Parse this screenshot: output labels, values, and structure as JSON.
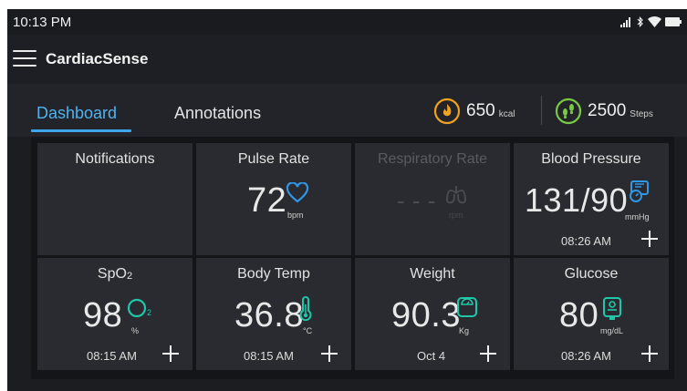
{
  "status_bar": {
    "time": "10:13 PM"
  },
  "app": {
    "title": "CardiacSense"
  },
  "tabs": [
    {
      "label": "Dashboard",
      "active": true
    },
    {
      "label": "Annotations",
      "active": false
    }
  ],
  "summary": {
    "calories": {
      "value": "650",
      "unit": "kcal",
      "icon": "flame-icon"
    },
    "steps": {
      "value": "2500",
      "unit": "Steps",
      "icon": "footsteps-icon"
    }
  },
  "tiles": [
    {
      "name": "Notifications"
    },
    {
      "name": "Pulse Rate",
      "value": "72",
      "unit": "bpm",
      "icon": "heart-icon"
    },
    {
      "name": "Respiratory Rate",
      "value": "- - -",
      "unit": "rpm",
      "icon": "lungs-icon",
      "disabled": true
    },
    {
      "name": "Blood Pressure",
      "value": "131/90",
      "unit": "mmHg",
      "time": "08:26 AM",
      "icon": "blood-pressure-icon"
    },
    {
      "name": "SpO2",
      "name_main": "SpO",
      "name_sub": "2",
      "value": "98",
      "unit": "%",
      "time": "08:15 AM",
      "icon": "o2-icon",
      "icon_sub": "2"
    },
    {
      "name": "Body Temp",
      "value": "36.8",
      "unit": "°C",
      "time": "08:15 AM",
      "icon": "thermometer-icon"
    },
    {
      "name": "Weight",
      "value": "90.3",
      "unit": "Kg",
      "time": "Oct 4",
      "icon": "scale-icon"
    },
    {
      "name": "Glucose",
      "value": "80",
      "unit": "mg/dL",
      "time": "08:26 AM",
      "icon": "glucometer-icon"
    }
  ],
  "colors": {
    "accent_blue": "#3ea7ea",
    "icon_blue": "#2f97e6",
    "icon_teal": "#1fc6a8",
    "kcal_orange": "#f1a21e",
    "steps_green": "#7ac943"
  }
}
